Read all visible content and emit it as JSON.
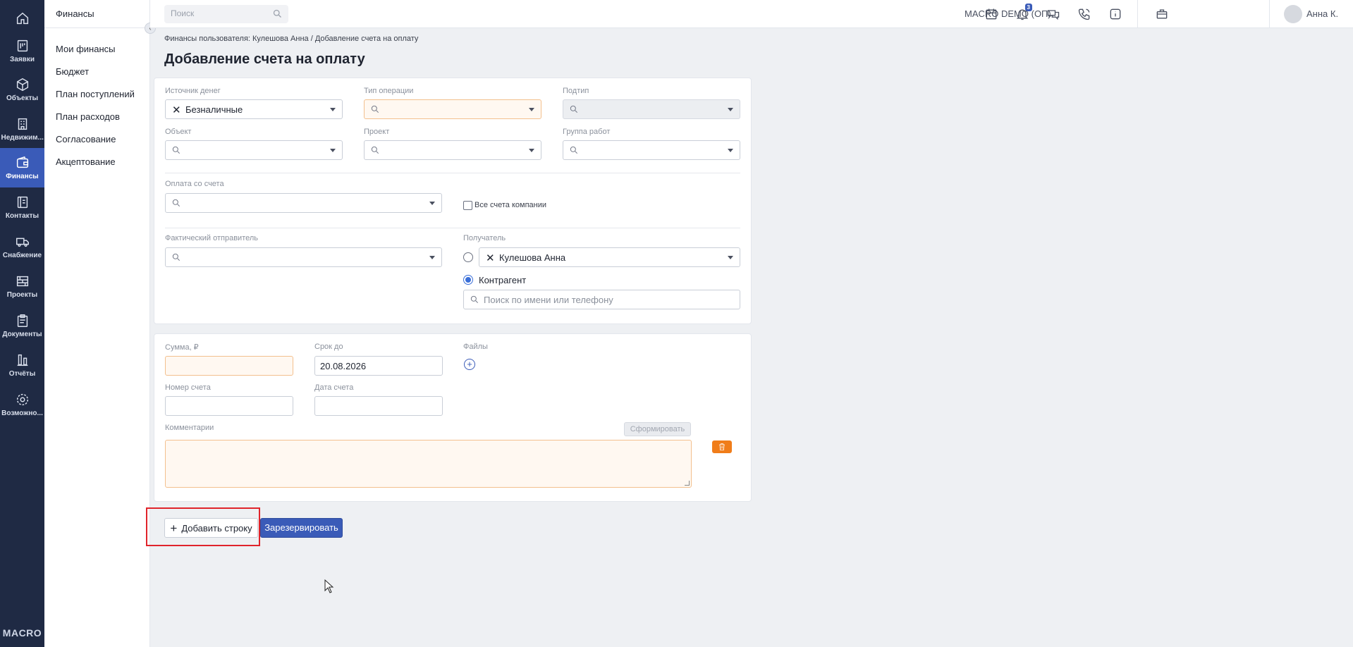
{
  "nav_rail": {
    "items": [
      {
        "label": "",
        "icon": "home-icon"
      },
      {
        "label": "Заявки",
        "icon": "requests-icon"
      },
      {
        "label": "Объекты",
        "icon": "cube-icon"
      },
      {
        "label": "Недвижим...",
        "icon": "building-icon"
      },
      {
        "label": "Финансы",
        "icon": "wallet-icon"
      },
      {
        "label": "Контакты",
        "icon": "contacts-icon"
      },
      {
        "label": "Снабжение",
        "icon": "truck-icon"
      },
      {
        "label": "Проекты",
        "icon": "projects-icon"
      },
      {
        "label": "Документы",
        "icon": "clipboard-icon"
      },
      {
        "label": "Отчёты",
        "icon": "chart-icon"
      },
      {
        "label": "Возможно...",
        "icon": "gear-icon"
      }
    ],
    "logo": "MACRO",
    "active_color": "#3a5bb8"
  },
  "sub_sidebar": {
    "title": "Финансы",
    "items": [
      "Мои финансы",
      "Бюджет",
      "План поступлений",
      "План расходов",
      "Согласование",
      "Акцептование"
    ]
  },
  "topbar": {
    "search_placeholder": "Поиск",
    "notification_count": "3",
    "company": "MACRO DEMO (ОП)",
    "user": "Анна К."
  },
  "breadcrumb": "Финансы пользователя: Кулешова Анна  /  Добавление счета на оплату",
  "page_title": "Добавление счета на оплату",
  "form1": {
    "source_label": "Источник денег",
    "source_value": "Безналичные",
    "op_type_label": "Тип операции",
    "subtype_label": "Подтип",
    "object_label": "Объект",
    "project_label": "Проект",
    "workgroup_label": "Группа работ",
    "pay_from_label": "Оплата со счета",
    "all_accounts_label": "Все счета компании",
    "sender_label": "Фактический отправитель",
    "recipient_label": "Получатель",
    "recipient_value": "Кулешова Анна",
    "counterparty_label": "Контрагент",
    "counterparty_placeholder": "Поиск по имени или телефону"
  },
  "form2": {
    "sum_label": "Сумма, ₽",
    "due_label": "Срок до",
    "due_value": "20.08.2026",
    "files_label": "Файлы",
    "invoice_num_label": "Номер счета",
    "invoice_date_label": "Дата счета",
    "comment_label": "Комментарии",
    "generate_button": "Сформировать"
  },
  "actions": {
    "add_row": "Добавить строку",
    "reserve": "Зарезервировать"
  },
  "colors": {
    "accent": "#3a5bb8",
    "warning_field": "#fff8f1",
    "delete": "#f07d1a",
    "highlight": "#e0242b"
  }
}
